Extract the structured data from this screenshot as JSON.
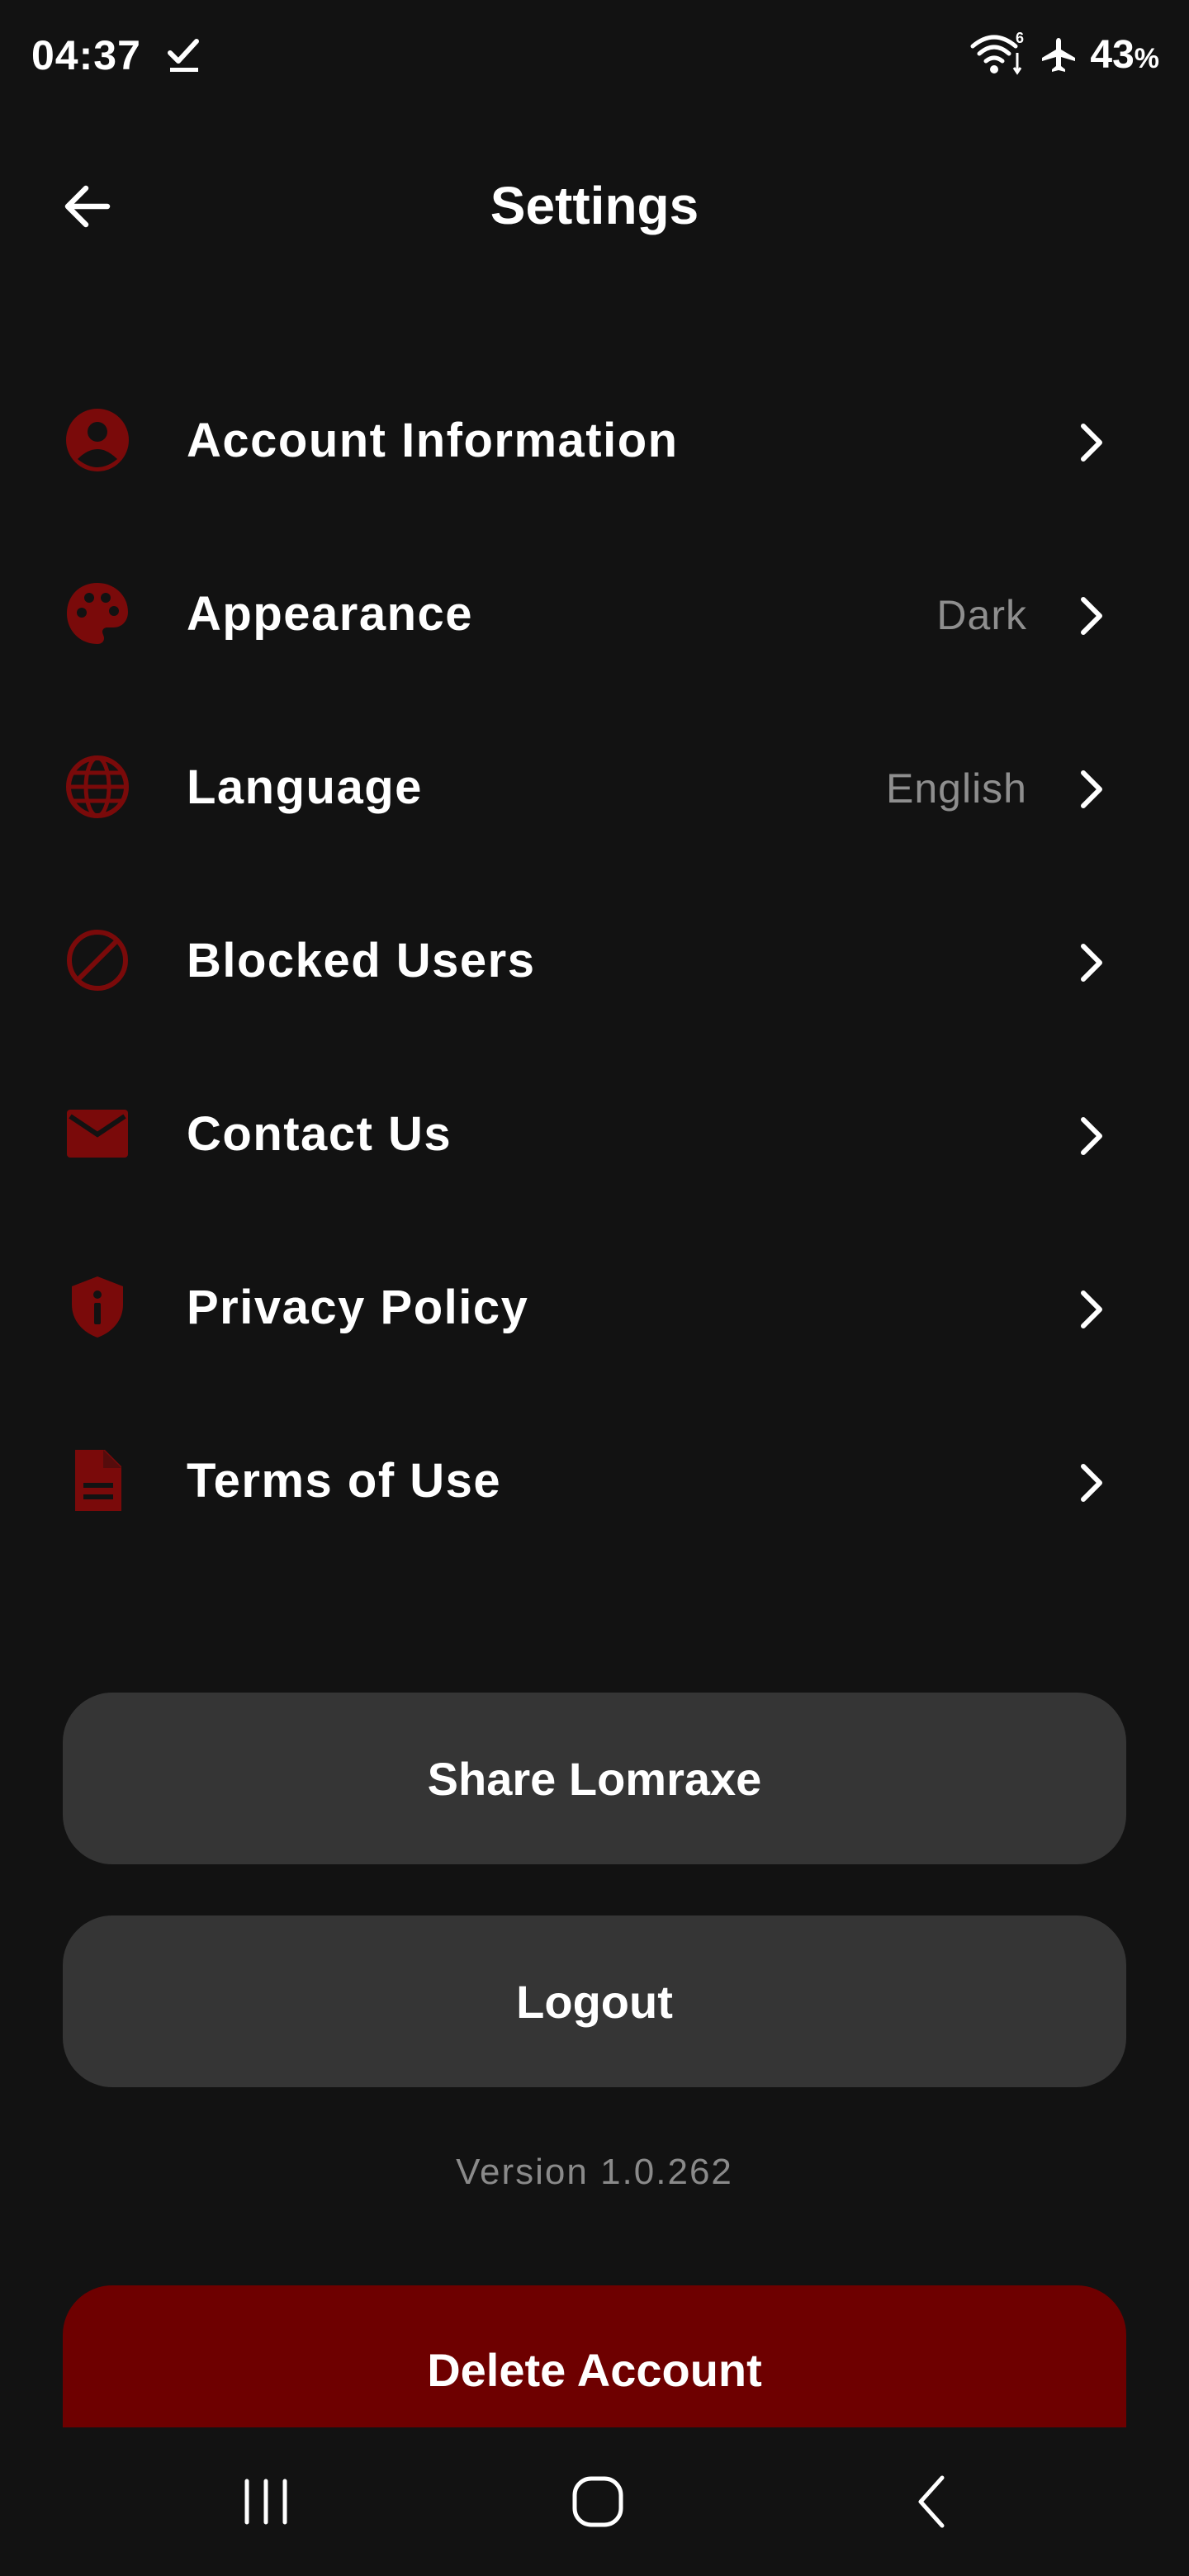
{
  "status_bar": {
    "time": "04:37",
    "battery_level": "43",
    "battery_unit": "%",
    "signal_label": "6"
  },
  "app_bar": {
    "title": "Settings",
    "back_icon": "arrow-left-icon"
  },
  "settings": {
    "items": [
      {
        "label": "Account Information",
        "value": "",
        "icon": "account-circle-icon"
      },
      {
        "label": "Appearance",
        "value": "Dark",
        "icon": "palette-icon"
      },
      {
        "label": "Language",
        "value": "English",
        "icon": "globe-icon"
      },
      {
        "label": "Blocked Users",
        "value": "",
        "icon": "block-icon"
      },
      {
        "label": "Contact Us",
        "value": "",
        "icon": "mail-icon"
      },
      {
        "label": "Privacy Policy",
        "value": "",
        "icon": "shield-info-icon"
      },
      {
        "label": "Terms of Use",
        "value": "",
        "icon": "document-icon"
      }
    ]
  },
  "actions": {
    "share_label": "Share Lomraxe",
    "logout_label": "Logout",
    "version": "Version 1.0.262",
    "delete_label": "Delete Account"
  },
  "colors": {
    "background": "#121212",
    "accent": "#6e0000",
    "icon": "#7a0a0a",
    "button": "#353535",
    "secondary_text": "#8e8e8e"
  },
  "nav": {
    "recents_icon": "recents-icon",
    "home_icon": "home-icon",
    "back_icon": "back-icon"
  }
}
